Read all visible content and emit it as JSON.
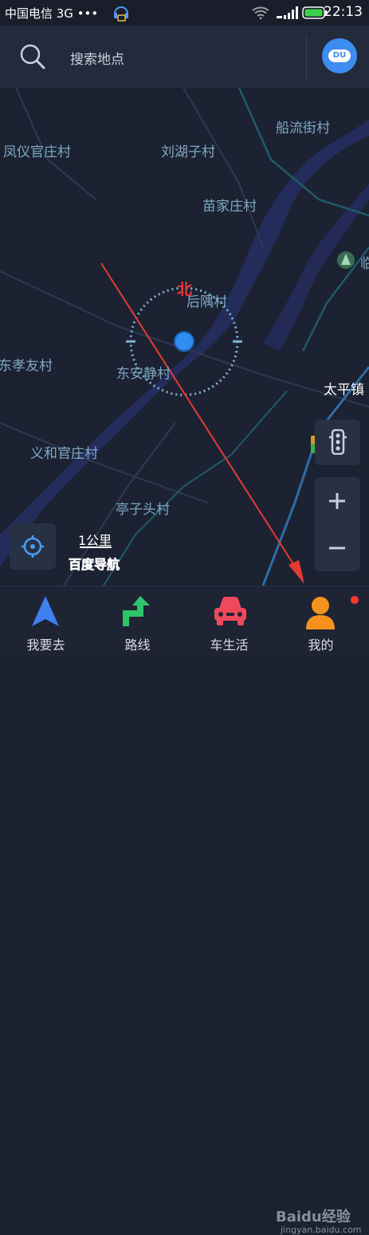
{
  "status_bar": {
    "carrier": "中国电信 3G •••",
    "time": "22:13"
  },
  "search": {
    "placeholder": "搜索地点"
  },
  "avatar": {
    "text": "DU"
  },
  "map": {
    "places": [
      "船流街村",
      "凤仪官庄村",
      "刘湖子村",
      "苗家庄村",
      "后隅村",
      "东孝友村",
      "东安静村",
      "义和官庄村",
      "亭子头村",
      "太平镇",
      "临"
    ],
    "compass_north": "北",
    "scale_label": "1公里",
    "logo": "百度导航"
  },
  "tabs": [
    {
      "label": "我要去",
      "icon": "navigate-arrow-icon"
    },
    {
      "label": "路线",
      "icon": "route-icon"
    },
    {
      "label": "车生活",
      "icon": "car-icon"
    },
    {
      "label": "我的",
      "icon": "user-icon"
    }
  ],
  "watermark": {
    "brand": "Baidu经验",
    "url": "jingyan.baidu.com"
  },
  "colors": {
    "accent": "#3d8cf0",
    "north": "#e53b35",
    "notify": "#ff3b30"
  }
}
